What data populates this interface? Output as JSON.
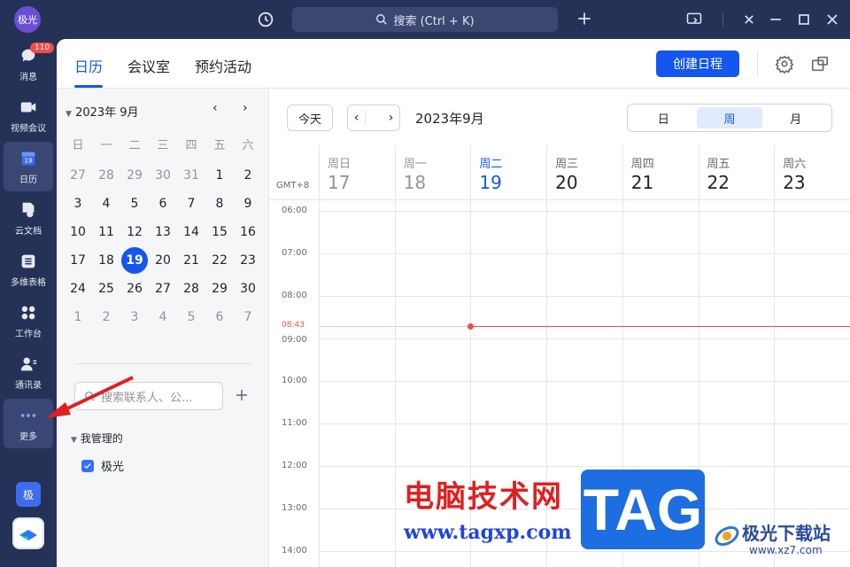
{
  "topbar": {
    "avatar_text": "极光",
    "search_placeholder": "搜索 (Ctrl + K)"
  },
  "rail": {
    "badge_count": "110",
    "items": [
      {
        "label": "消息",
        "icon": "chat-bubble-icon"
      },
      {
        "label": "视频会议",
        "icon": "video-camera-icon"
      },
      {
        "label": "日历",
        "icon": "calendar-icon"
      },
      {
        "label": "云文档",
        "icon": "cloud-doc-icon"
      },
      {
        "label": "多维表格",
        "icon": "table-icon"
      },
      {
        "label": "工作台",
        "icon": "grid-apps-icon"
      },
      {
        "label": "通讯录",
        "icon": "contacts-icon"
      },
      {
        "label": "更多",
        "icon": "more-dots-icon"
      }
    ],
    "bottom_badge": "极"
  },
  "tabs": [
    {
      "label": "日历"
    },
    {
      "label": "会议室"
    },
    {
      "label": "预约活动"
    }
  ],
  "create_button": "创建日程",
  "sidebar": {
    "month_label": "2023年 9月",
    "weekdays": [
      "日",
      "一",
      "二",
      "三",
      "四",
      "五",
      "六"
    ],
    "weeks": [
      [
        "27",
        "28",
        "29",
        "30",
        "31",
        "1",
        "2"
      ],
      [
        "3",
        "4",
        "5",
        "6",
        "7",
        "8",
        "9"
      ],
      [
        "10",
        "11",
        "12",
        "13",
        "14",
        "15",
        "16"
      ],
      [
        "17",
        "18",
        "19",
        "20",
        "21",
        "22",
        "23"
      ],
      [
        "24",
        "25",
        "26",
        "27",
        "28",
        "29",
        "30"
      ],
      [
        "1",
        "2",
        "3",
        "4",
        "5",
        "6",
        "7"
      ]
    ],
    "selected_day": "19",
    "contact_search_placeholder": "搜索联系人、公...",
    "group_title": "我管理的",
    "calendars": [
      {
        "name": "极光",
        "checked": true,
        "color": "#3370ff"
      }
    ]
  },
  "calendar": {
    "today_button": "今天",
    "current_month": "2023年9月",
    "views": [
      "日",
      "周",
      "月"
    ],
    "active_view": "周",
    "timezone": "GMT+8",
    "days": [
      {
        "weekday": "周日",
        "date": "17"
      },
      {
        "weekday": "周一",
        "date": "18"
      },
      {
        "weekday": "周二",
        "date": "19"
      },
      {
        "weekday": "周三",
        "date": "20"
      },
      {
        "weekday": "周四",
        "date": "21"
      },
      {
        "weekday": "周五",
        "date": "22"
      },
      {
        "weekday": "周六",
        "date": "23"
      }
    ],
    "times": [
      "06:00",
      "07:00",
      "08:00",
      "09:00",
      "10:00",
      "11:00",
      "12:00",
      "13:00",
      "14:00"
    ],
    "now_time": "08:43"
  },
  "watermark": {
    "cn_text": "电脑技术网",
    "url": "www.tagxp.com",
    "tag": "TAG",
    "site_name": "极光下载站",
    "site_url": "www.xz7.com"
  },
  "colors": {
    "accent": "#1456f0",
    "rail_bg": "#253257",
    "now_line": "#f54a45"
  }
}
